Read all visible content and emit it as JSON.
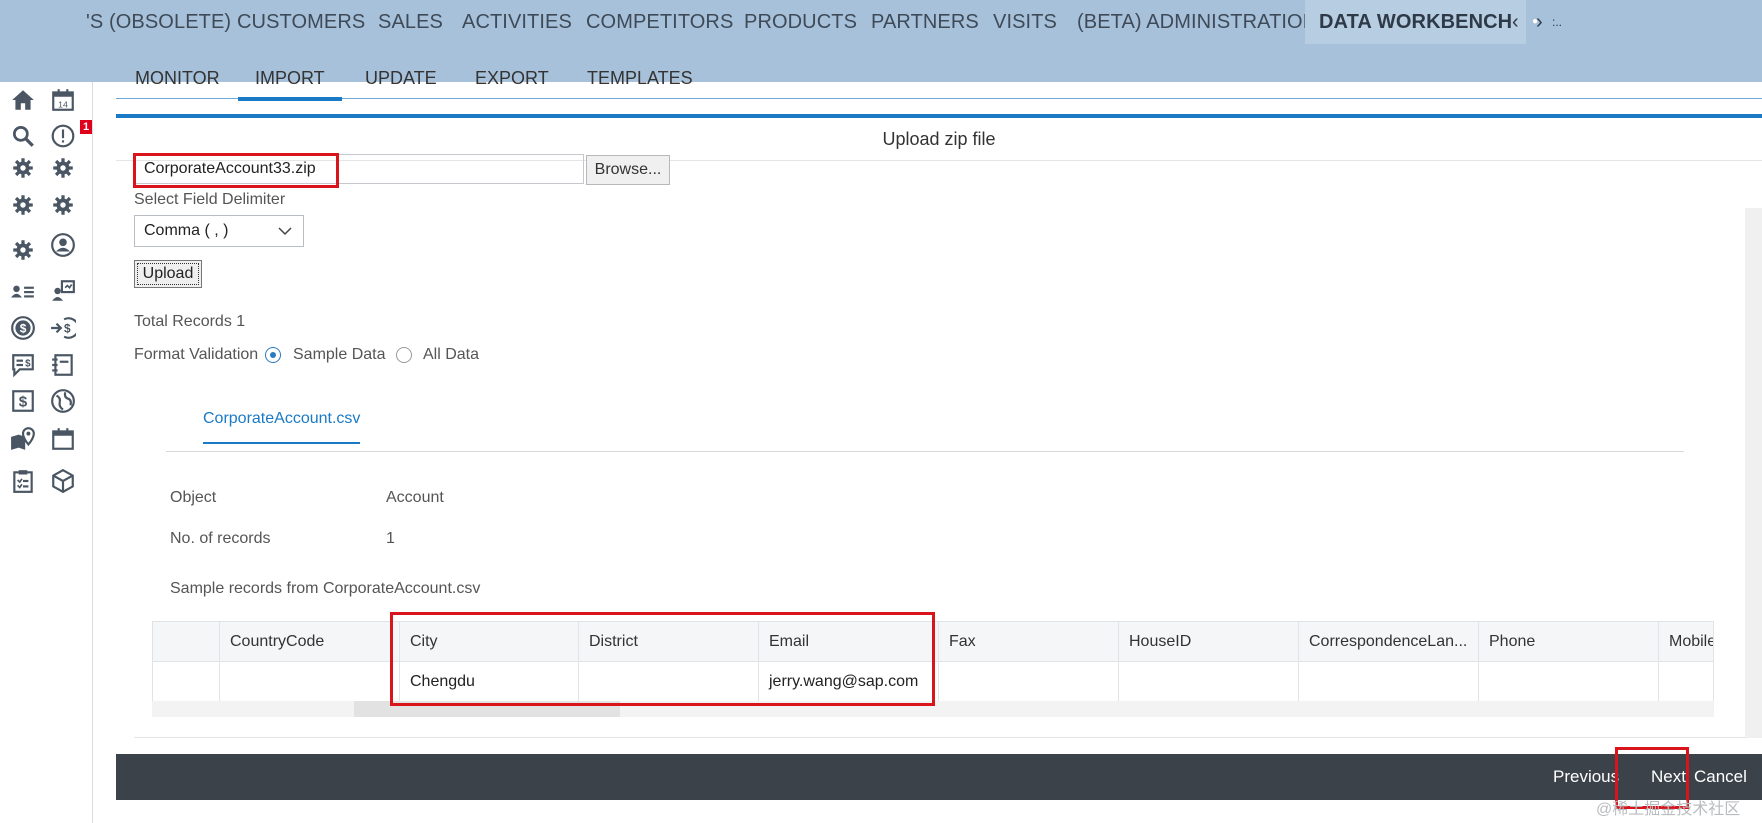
{
  "top_nav": {
    "items": [
      "'S (OBSOLETE)",
      "CUSTOMERS",
      "SALES",
      "ACTIVITIES",
      "COMPETITORS",
      "PRODUCTS",
      "PARTNERS",
      "VISITS",
      "(BETA) ADMINISTRATION",
      "DATA WORKBENCH"
    ],
    "active": "DATA WORKBENCH",
    "prev_arrow": "‹",
    "next_arrow": "›",
    "more": ":.."
  },
  "sidebar": {
    "icons": [
      "home-icon",
      "calendar-icon",
      "search-icon",
      "alert-icon",
      "gear-icon",
      "gear-icon",
      "gear-icon",
      "gear-icon",
      "gear-icon",
      "user-circle-icon",
      "contacts-list-icon",
      "contact-card-icon",
      "dollar-coin-icon",
      "dollar-in-icon",
      "chat-dollar-icon",
      "notebook-icon",
      "dollar-document-icon",
      "globe-icon",
      "map-pin-icon",
      "calendar-range-icon",
      "checklist-icon",
      "cube-icon"
    ],
    "alert_badge": "1"
  },
  "subtabs": [
    "MONITOR",
    "IMPORT",
    "UPDATE",
    "EXPORT",
    "TEMPLATES"
  ],
  "active_subtab": "IMPORT",
  "dialog": {
    "title": "Upload zip file",
    "file_name": "CorporateAccount33.zip",
    "browse_label": "Browse...",
    "delimiter_label": "Select Field Delimiter",
    "delimiter_value": "Comma  ( , )",
    "upload_label": "Upload",
    "total_records_label": "Total Records 1",
    "format_validation_label": "Format Validation",
    "radio_sample": "Sample Data",
    "radio_all": "All Data",
    "selected_radio": "Sample Data"
  },
  "file_tab": "CorporateAccount.csv",
  "details": {
    "object_label": "Object",
    "object_value": "Account",
    "records_label": "No. of records",
    "records_value": "1",
    "sample_label": "Sample records from CorporateAccount.csv"
  },
  "table": {
    "columns": [
      "",
      "CountryCode",
      "City",
      "District",
      "Email",
      "Fax",
      "HouseID",
      "CorrespondenceLan...",
      "Phone",
      "Mobile"
    ],
    "row": [
      "",
      "",
      "Chengdu",
      "",
      "jerry.wang@sap.com",
      "",
      "",
      "",
      "",
      ""
    ]
  },
  "footer": {
    "previous": "Previous",
    "next": "Next",
    "cancel": "Cancel"
  },
  "watermark": "@稀土掘金技术社区",
  "colors": {
    "topbar": "#a7c1da",
    "accent": "#1a7ac5",
    "footer": "#3b4249",
    "highlight": "#d9141b"
  }
}
